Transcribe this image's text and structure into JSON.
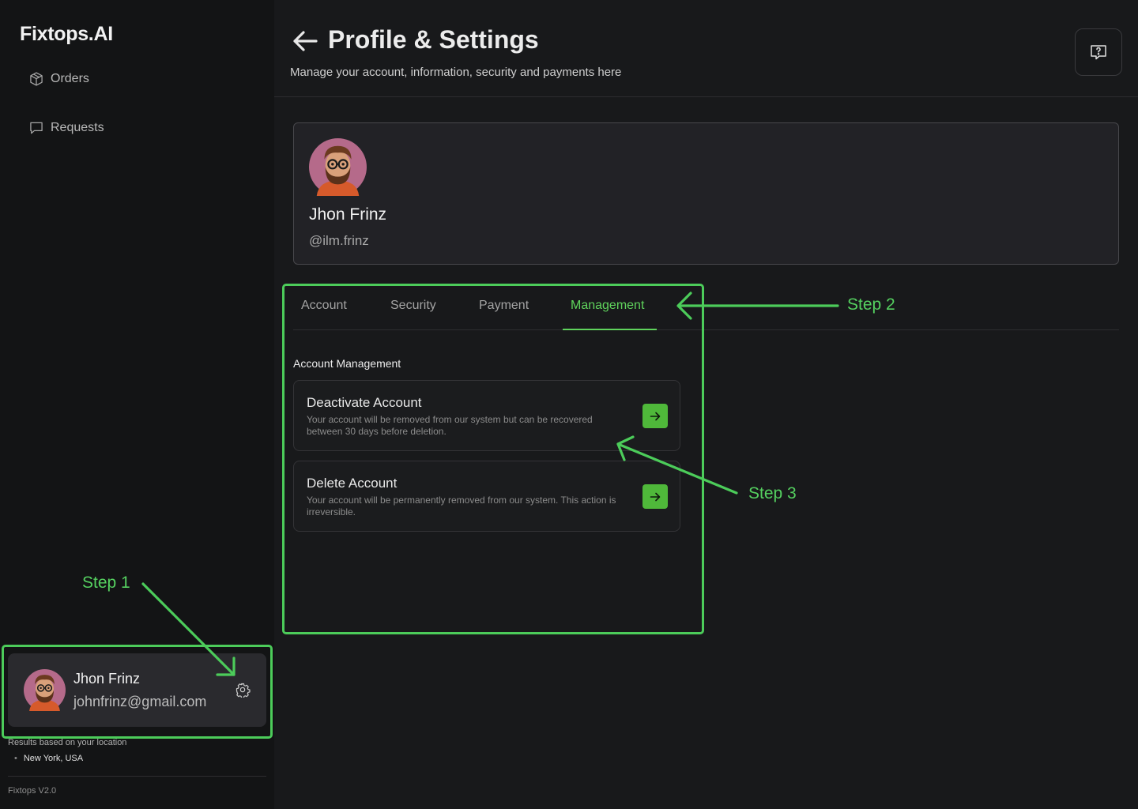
{
  "app": {
    "brand": "Fixtops.AI",
    "version": "Fixtops V2.0"
  },
  "sidebar": {
    "items": [
      {
        "label": "Orders",
        "icon": "package-icon"
      },
      {
        "label": "Requests",
        "icon": "chat-icon"
      }
    ],
    "user": {
      "name": "Jhon Frinz",
      "email": "johnfrinz@gmail.com"
    },
    "location_label": "Results based on your location",
    "location_value": "New York, USA"
  },
  "header": {
    "title": "Profile & Settings",
    "subtitle": "Manage your account, information, security and payments here"
  },
  "profile": {
    "name": "Jhon Frinz",
    "handle": "@ilm.frinz"
  },
  "tabs": [
    {
      "label": "Account"
    },
    {
      "label": "Security"
    },
    {
      "label": "Payment"
    },
    {
      "label": "Management",
      "active": true
    }
  ],
  "management": {
    "section_title": "Account Management",
    "cards": [
      {
        "title": "Deactivate Account",
        "description": "Your account will be removed from our system but can be recovered between 30 days before deletion."
      },
      {
        "title": "Delete Account",
        "description": "Your account will be permanently removed from our system. This action is irreversible."
      }
    ]
  },
  "annotations": {
    "step1": "Step 1",
    "step2": "Step 2",
    "step3": "Step 3"
  },
  "colors": {
    "accent": "#5fd35c",
    "annotation": "#4ccc5a",
    "button_green": "#4fb83a",
    "background": "#18191b",
    "sidebar": "#131415"
  }
}
